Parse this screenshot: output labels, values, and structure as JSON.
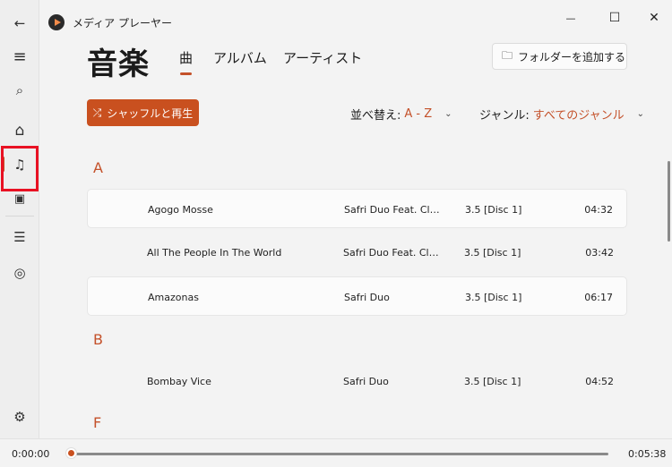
{
  "window": {
    "title": "メディア プレーヤー",
    "minimize": "—",
    "maximize": "☐",
    "close": "✕"
  },
  "rail": {
    "back": "←",
    "menu": "≡",
    "search": "⌕",
    "home": "⌂",
    "music": "♫",
    "video": "▣",
    "playqueue": "☰",
    "playlists": "◎",
    "settings": "⚙"
  },
  "header": {
    "title": "音楽",
    "tabs": [
      {
        "label": "曲"
      },
      {
        "label": "アルバム"
      },
      {
        "label": "アーティスト"
      }
    ],
    "add_folder": "フォルダーを追加する",
    "add_folder_icon": "🗀"
  },
  "controls": {
    "shuffle_label": "シャッフルと再生",
    "shuffle_icon": "⤮",
    "sort_label": "並べ替え:",
    "sort_value": "A - Z",
    "genre_label": "ジャンル:",
    "genre_value": "すべてのジャンル",
    "chevron": "⌄"
  },
  "groups": [
    {
      "letter": "A"
    },
    {
      "letter": "B"
    },
    {
      "letter": "F"
    }
  ],
  "songs": [
    {
      "title": "Agogo Mosse",
      "artist": "Safri Duo Feat. Clark...",
      "album": "3.5 [Disc 1]",
      "duration": "04:32"
    },
    {
      "title": "All The People In The World",
      "artist": "Safri Duo Feat. Clark...",
      "album": "3.5 [Disc 1]",
      "duration": "03:42"
    },
    {
      "title": "Amazonas",
      "artist": "Safri Duo",
      "album": "3.5 [Disc 1]",
      "duration": "06:17"
    },
    {
      "title": "Bombay Vice",
      "artist": "Safri Duo",
      "album": "3.5 [Disc 1]",
      "duration": "04:52"
    }
  ],
  "player": {
    "elapsed": "0:00:00",
    "total": "0:05:38",
    "progress": 0
  }
}
